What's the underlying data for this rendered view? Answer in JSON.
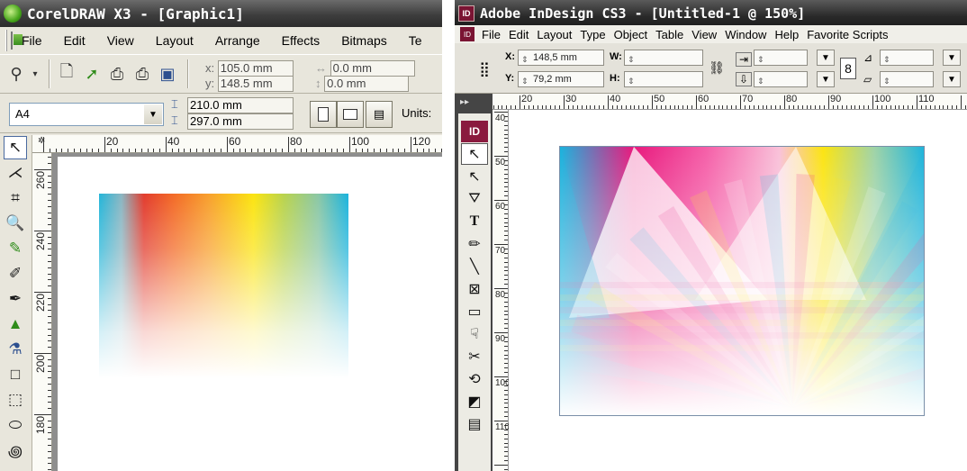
{
  "corel": {
    "title": "CorelDRAW X3 - [Graphic1]",
    "menu": [
      "File",
      "Edit",
      "View",
      "Layout",
      "Arrange",
      "Effects",
      "Bitmaps",
      "Te"
    ],
    "x_label": "x:",
    "y_label": "y:",
    "x_value": "105.0 mm",
    "y_value": "148.5 mm",
    "w_value": "0.0 mm",
    "h_value": "0.0 mm",
    "paper_size": "A4",
    "page_width": "210.0 mm",
    "page_height": "297.0 mm",
    "units_label": "Units:",
    "hruler_labels": [
      "20",
      "40",
      "60",
      "80",
      "100",
      "120"
    ],
    "vruler_labels": [
      "260",
      "240",
      "220",
      "200",
      "180"
    ],
    "tools": [
      "pick-tool",
      "shape-tool",
      "crop-tool",
      "zoom-tool",
      "freehand-tool",
      "smart-fill-tool",
      "artistic-media-tool",
      "interactive-fill-tool",
      "eyedropper-tool",
      "rectangle-tool",
      "graph-paper-tool",
      "ellipse-tool",
      "spiral-tool"
    ],
    "gradient_colors": [
      "#24b5d8",
      "#e23c2e",
      "#f36b27",
      "#f8a02d",
      "#fbe411",
      "#b9d34d",
      "#1ab3dd"
    ]
  },
  "indd": {
    "title": "Adobe InDesign CS3 - [Untitled-1 @ 150%]",
    "logo_text": "ID",
    "menu": [
      "File",
      "Edit",
      "Layout",
      "Type",
      "Object",
      "Table",
      "View",
      "Window",
      "Help",
      "Favorite Scripts"
    ],
    "x_label": "X:",
    "y_label": "Y:",
    "w_label": "W:",
    "h_label": "H:",
    "x_value": "148,5 mm",
    "y_value": "79,2 mm",
    "w_value": "",
    "h_value": "",
    "hruler_labels": [
      "20",
      "30",
      "40",
      "50",
      "60",
      "70",
      "80",
      "90",
      "100",
      "110"
    ],
    "vruler_labels": [
      "40",
      "50",
      "60",
      "70",
      "80",
      "90",
      "100",
      "110"
    ],
    "tools": [
      "selection-tool",
      "direct-selection-tool",
      "pen-tool",
      "type-tool",
      "pencil-tool",
      "line-tool",
      "rectangle-frame-tool",
      "rectangle-tool",
      "button-tool",
      "scissors-tool",
      "free-transform-tool",
      "gradient-tool",
      "note-tool"
    ],
    "art_colors": [
      "#1ab3dd",
      "#e8197d",
      "#fbe411",
      "#ffffff"
    ]
  }
}
